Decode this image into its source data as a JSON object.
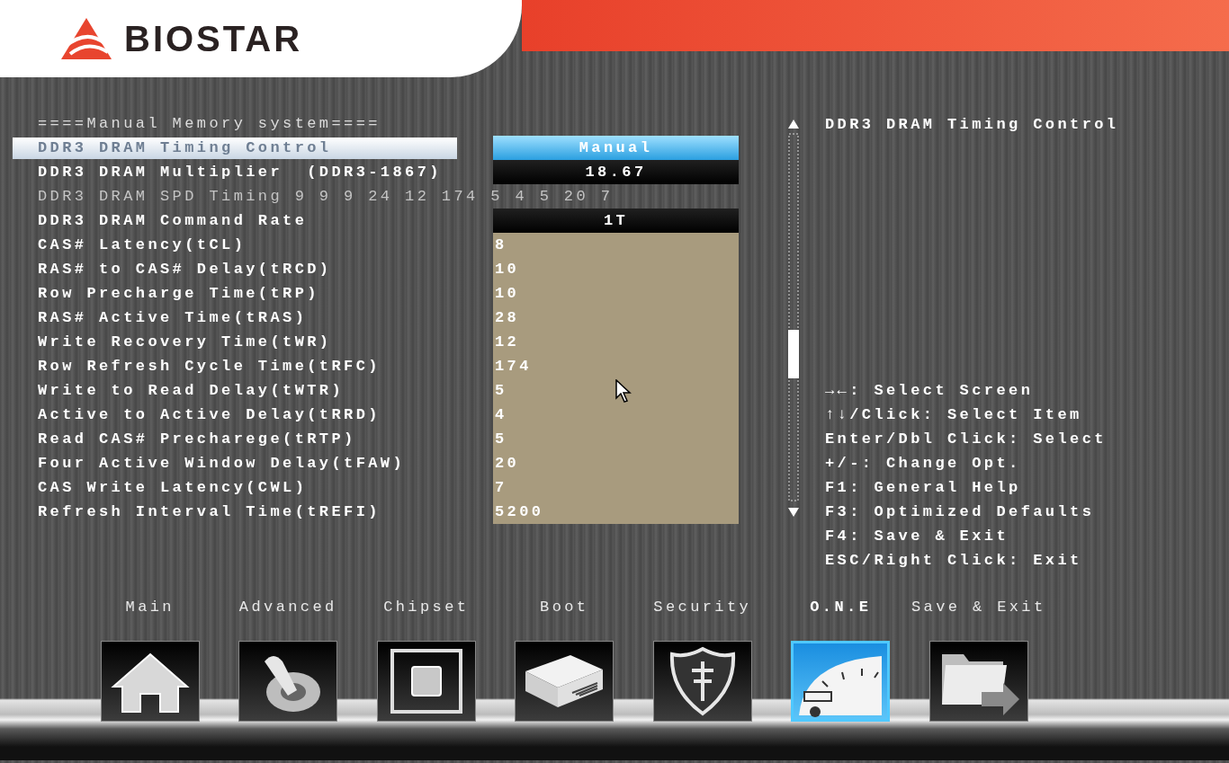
{
  "logo": {
    "text": "BIOSTAR"
  },
  "section_title": "====Manual Memory system====",
  "items": [
    {
      "kind": "option",
      "label": "DDR3 DRAM Timing Control",
      "value": "Manual",
      "selected": true
    },
    {
      "kind": "value",
      "label": "DDR3 DRAM Multiplier  (DDR3-1867)",
      "value": "18.67",
      "selected": false
    },
    {
      "kind": "info",
      "label": "DDR3 DRAM SPD Timing 9 9 9 24 12 174 5 4 5 20 7",
      "selected": false
    },
    {
      "kind": "value",
      "label": "DDR3 DRAM Command Rate",
      "value": "1T",
      "selected": false
    },
    {
      "kind": "field",
      "label": "CAS# Latency(tCL)",
      "value": "8",
      "selected": false
    },
    {
      "kind": "field",
      "label": "RAS# to CAS# Delay(tRCD)",
      "value": "10",
      "selected": false
    },
    {
      "kind": "field",
      "label": "Row Precharge Time(tRP)",
      "value": "10",
      "selected": false
    },
    {
      "kind": "field",
      "label": "RAS# Active Time(tRAS)",
      "value": "28",
      "selected": false
    },
    {
      "kind": "field",
      "label": "Write Recovery Time(tWR)",
      "value": "12",
      "selected": false
    },
    {
      "kind": "field",
      "label": "Row Refresh Cycle Time(tRFC)",
      "value": "174",
      "selected": false
    },
    {
      "kind": "field",
      "label": "Write to Read Delay(tWTR)",
      "value": "5",
      "selected": false
    },
    {
      "kind": "field",
      "label": "Active to Active Delay(tRRD)",
      "value": "4",
      "selected": false
    },
    {
      "kind": "field",
      "label": "Read CAS# Precharege(tRTP)",
      "value": "5",
      "selected": false
    },
    {
      "kind": "field",
      "label": "Four Active Window Delay(tFAW)",
      "value": "20",
      "selected": false
    },
    {
      "kind": "field",
      "label": "CAS Write Latency(CWL)",
      "value": "7",
      "selected": false
    },
    {
      "kind": "field",
      "label": "Refresh Interval Time(tREFI)",
      "value": "5200",
      "selected": false
    }
  ],
  "help": {
    "title": "DDR3 DRAM Timing Control",
    "keys": [
      "→←: Select Screen",
      "↑↓/Click: Select Item",
      "Enter/Dbl Click: Select",
      "+/-: Change Opt.",
      "F1: General Help",
      "F3: Optimized Defaults",
      "F4: Save & Exit",
      "ESC/Right Click: Exit"
    ]
  },
  "tabs": [
    {
      "label": "Main",
      "selected": false
    },
    {
      "label": "Advanced",
      "selected": false
    },
    {
      "label": "Chipset",
      "selected": false
    },
    {
      "label": "Boot",
      "selected": false
    },
    {
      "label": "Security",
      "selected": false
    },
    {
      "label": "O.N.E",
      "selected": true
    },
    {
      "label": "Save & Exit",
      "selected": false
    }
  ]
}
